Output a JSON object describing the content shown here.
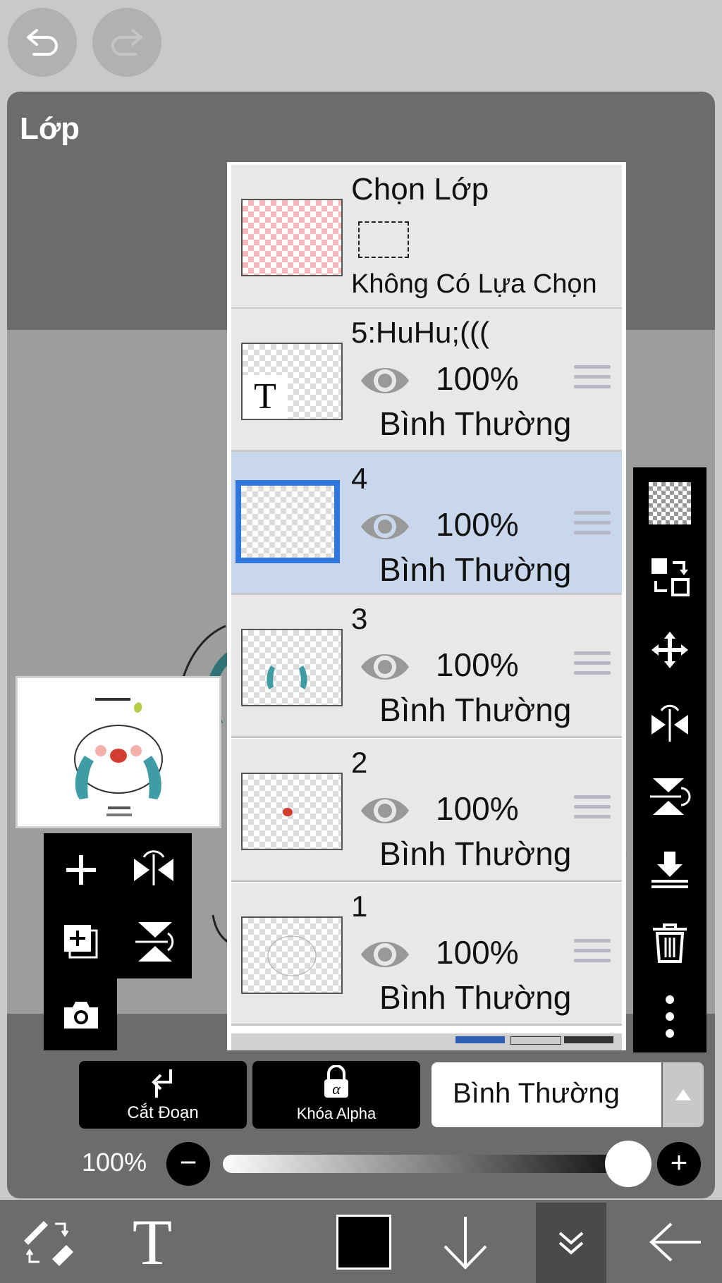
{
  "panel": {
    "title": "Lớp"
  },
  "selection_layer": {
    "title": "Chọn Lớp",
    "status": "Không Có Lựa Chọn"
  },
  "layers": [
    {
      "name": "5:HuHu;(((",
      "opacity": "100%",
      "blend": "Bình Thường",
      "selected": false
    },
    {
      "name": "4",
      "opacity": "100%",
      "blend": "Bình Thường",
      "selected": true
    },
    {
      "name": "3",
      "opacity": "100%",
      "blend": "Bình Thường",
      "selected": false
    },
    {
      "name": "2",
      "opacity": "100%",
      "blend": "Bình Thường",
      "selected": false
    },
    {
      "name": "1",
      "opacity": "100%",
      "blend": "Bình Thường",
      "selected": false
    }
  ],
  "thumb_text_glyph": "T",
  "actions": {
    "clipping": "Cắt Đoạn",
    "alpha_lock": "Khóa Alpha"
  },
  "blend_mode": {
    "selected": "Bình Thường"
  },
  "opacity": {
    "label": "100%",
    "value": 1.0
  },
  "bottom_toolbar": {
    "text_tool": "T"
  },
  "colors": {
    "selected_row": "#c9d7ec",
    "selected_border": "#2f78e0",
    "current_color": "#000000"
  }
}
